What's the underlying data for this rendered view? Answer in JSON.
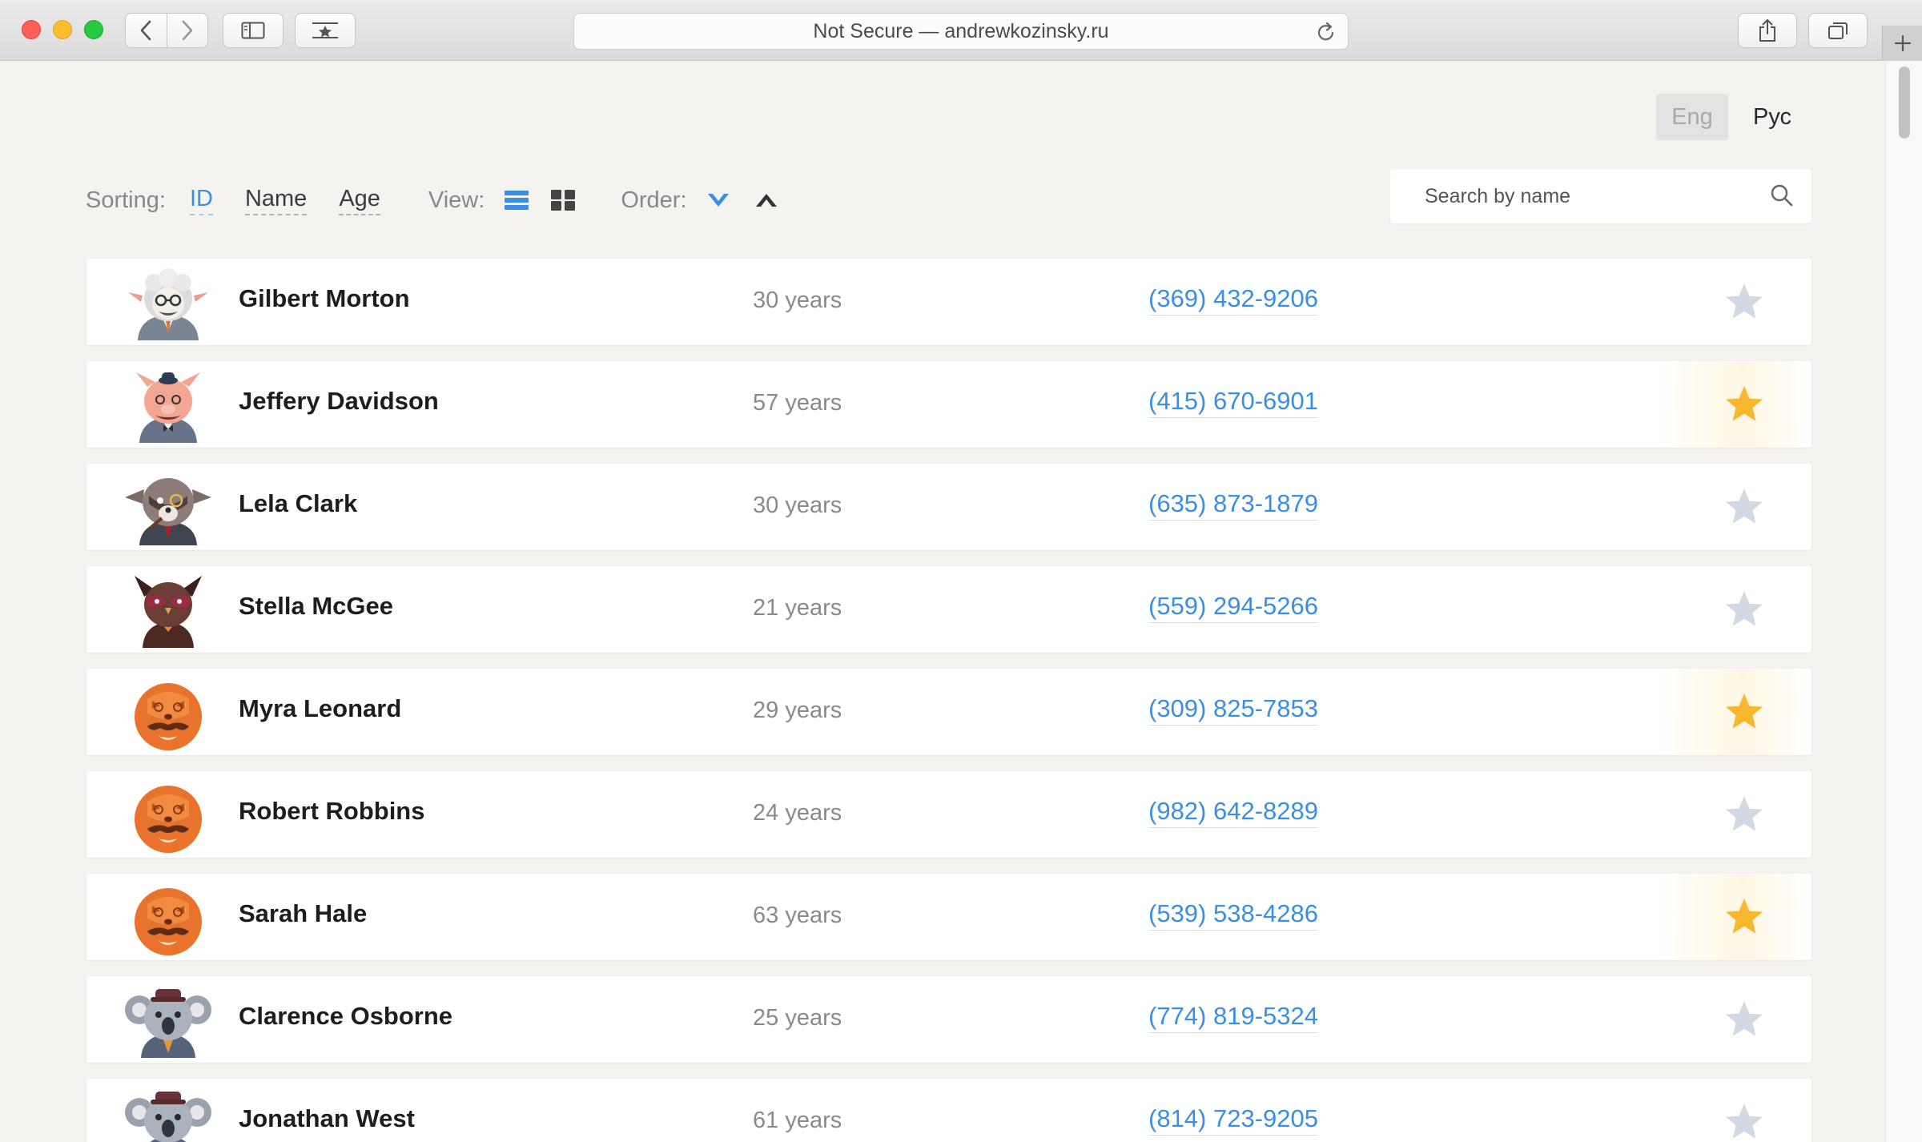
{
  "browser": {
    "url_text": "Not Secure — andrewkozinsky.ru"
  },
  "language": {
    "eng": "Eng",
    "rus": "Рус",
    "active": "Eng"
  },
  "controls": {
    "sorting_label": "Sorting:",
    "sort_options": [
      "ID",
      "Name",
      "Age"
    ],
    "active_sort": "ID",
    "view_label": "View:",
    "view_modes": [
      "list-icon",
      "grid-icon"
    ],
    "active_view": "list-icon",
    "order_label": "Order:",
    "order_modes": [
      "chevron-down-icon",
      "chevron-up-icon"
    ],
    "active_order": "chevron-down-icon"
  },
  "search": {
    "placeholder": "Search by name",
    "value": ""
  },
  "colors": {
    "accent": "#3a8ee6",
    "star_active": "#f7b731",
    "star_inactive": "#d2d9e3"
  },
  "people": [
    {
      "name": "Gilbert Morton",
      "age": "30 years",
      "phone": "(369) 432-9206",
      "favourite": false,
      "avatar": "sheep-avatar"
    },
    {
      "name": "Jeffery Davidson",
      "age": "57 years",
      "phone": "(415) 670-6901",
      "favourite": true,
      "avatar": "pig-avatar"
    },
    {
      "name": "Lela Clark",
      "age": "30 years",
      "phone": "(635) 873-1879",
      "favourite": false,
      "avatar": "raccoon-avatar"
    },
    {
      "name": "Stella McGee",
      "age": "21 years",
      "phone": "(559) 294-5266",
      "favourite": false,
      "avatar": "owl-avatar"
    },
    {
      "name": "Myra Leonard",
      "age": "29 years",
      "phone": "(309) 825-7853",
      "favourite": true,
      "avatar": "fox-avatar"
    },
    {
      "name": "Robert Robbins",
      "age": "24 years",
      "phone": "(982) 642-8289",
      "favourite": false,
      "avatar": "fox-avatar"
    },
    {
      "name": "Sarah Hale",
      "age": "63 years",
      "phone": "(539) 538-4286",
      "favourite": true,
      "avatar": "fox-avatar"
    },
    {
      "name": "Clarence Osborne",
      "age": "25 years",
      "phone": "(774) 819-5324",
      "favourite": false,
      "avatar": "koala-avatar"
    },
    {
      "name": "Jonathan West",
      "age": "61 years",
      "phone": "(814) 723-9205",
      "favourite": false,
      "avatar": "koala-avatar"
    }
  ]
}
